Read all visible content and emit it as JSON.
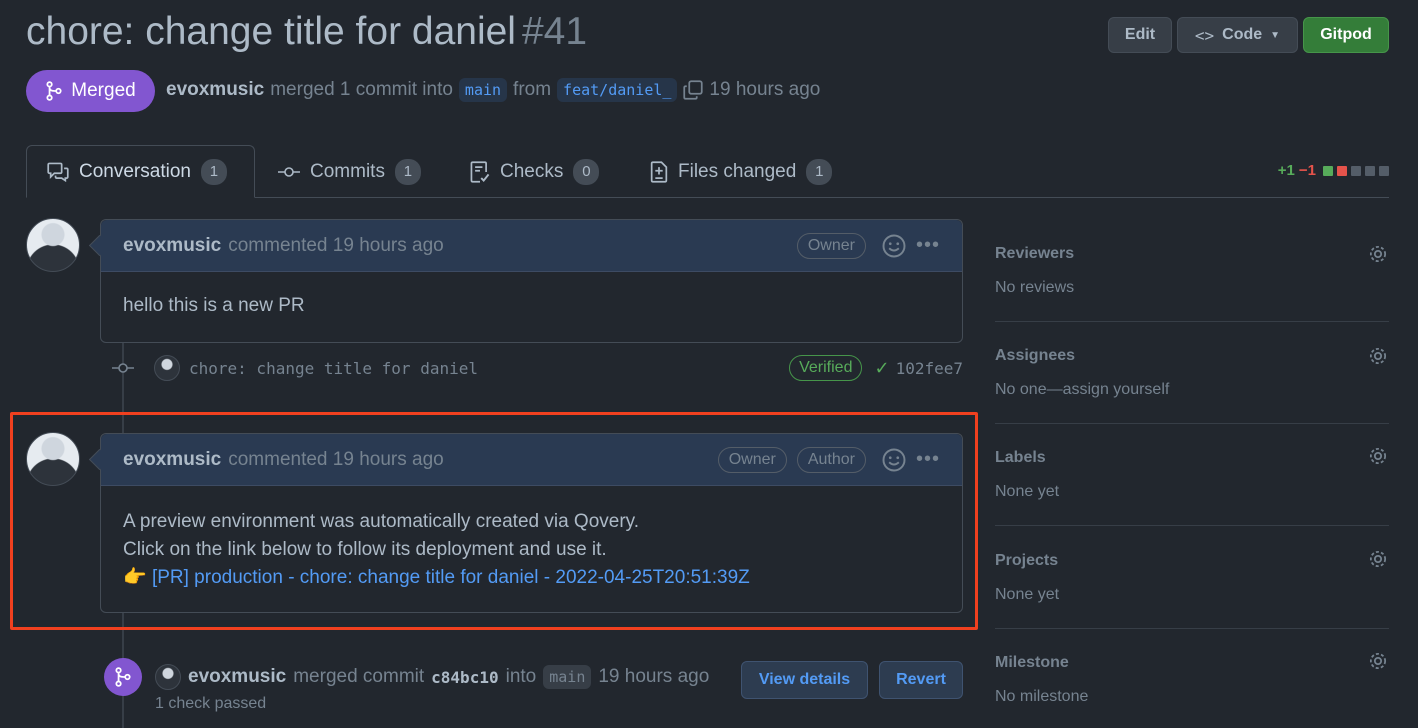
{
  "header": {
    "title": "chore: change title for daniel",
    "number": "#41",
    "edit_label": "Edit",
    "code_label": "Code",
    "gitpod_label": "Gitpod"
  },
  "status": {
    "badge": "Merged",
    "author": "evoxmusic",
    "action": "merged 1 commit into",
    "base_branch": "main",
    "from_word": "from",
    "head_branch": "feat/daniel_",
    "time": "19 hours ago"
  },
  "tabs": [
    {
      "label": "Conversation",
      "count": "1",
      "icon": "comment-discussion-icon"
    },
    {
      "label": "Commits",
      "count": "1",
      "icon": "git-commit-icon"
    },
    {
      "label": "Checks",
      "count": "0",
      "icon": "checklist-icon"
    },
    {
      "label": "Files changed",
      "count": "1",
      "icon": "file-diff-icon"
    }
  ],
  "diffstat": {
    "additions": "+1",
    "deletions": "−1"
  },
  "comments": [
    {
      "author": "evoxmusic",
      "meta": "commented 19 hours ago",
      "labels": [
        "Owner"
      ],
      "body": [
        "hello this is a new PR"
      ]
    },
    {
      "author": "evoxmusic",
      "meta": "commented 19 hours ago",
      "labels": [
        "Owner",
        "Author"
      ],
      "body": [
        "A preview environment was automatically created via Qovery.",
        "Click on the link below to follow its deployment and use it."
      ],
      "link_emoji": "👉",
      "link_text": "[PR] production - chore: change title for daniel - 2022-04-25T20:51:39Z"
    }
  ],
  "commit": {
    "message": "chore: change title for daniel",
    "verified": "Verified",
    "sha": "102fee7"
  },
  "merge_event": {
    "author": "evoxmusic",
    "text": "merged commit",
    "sha": "c84bc10",
    "into": "into",
    "branch": "main",
    "time": "19 hours ago",
    "checks": "1 check passed",
    "view_details": "View details",
    "revert": "Revert"
  },
  "sidebar": [
    {
      "heading": "Reviewers",
      "value": "No reviews"
    },
    {
      "heading": "Assignees",
      "value": "No one—assign yourself"
    },
    {
      "heading": "Labels",
      "value": "None yet"
    },
    {
      "heading": "Projects",
      "value": "None yet"
    },
    {
      "heading": "Milestone",
      "value": "No milestone"
    }
  ],
  "colors": {
    "background": "#22272e",
    "merged": "#8256d0",
    "gitpod": "#347d39",
    "link": "#539bf5",
    "highlight": "#f0401f"
  }
}
